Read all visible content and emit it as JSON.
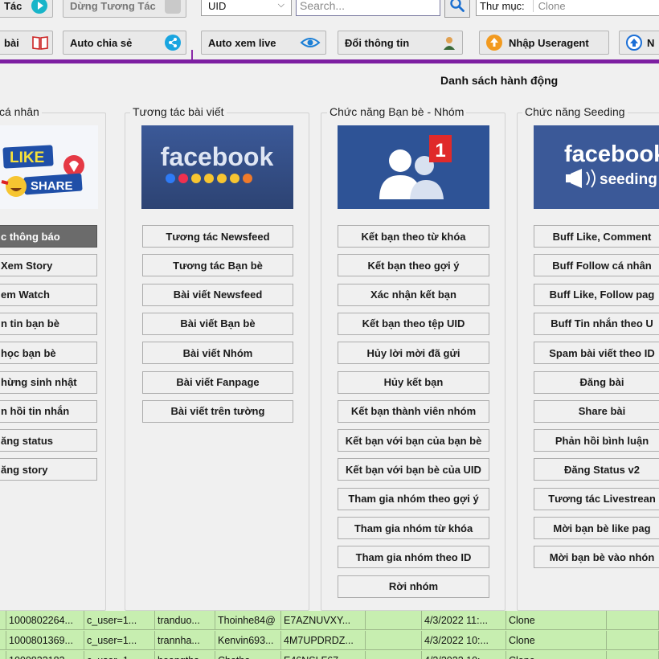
{
  "toolbar": {
    "row1": {
      "start_interact_label": "Tác",
      "stop_interact_label": "Dừng Tương Tác",
      "filter_select_value": "UID",
      "search_placeholder": "Search...",
      "folder_label": "Thư mục:",
      "folder_value": "Clone"
    },
    "row2": {
      "post_label": "bài",
      "auto_share_label": "Auto chia sẻ",
      "auto_live_label": "Auto xem live",
      "change_info_label": "Đổi thông tin",
      "import_useragent_label": "Nhập Useragent",
      "next_label": "N"
    }
  },
  "dialog": {
    "title": "Danh sách hành động",
    "groups": [
      {
        "title": "cá nhân",
        "banner_text": [
          "LIKE",
          "SHARE"
        ],
        "buttons": [
          "c thông báo",
          "Xem Story",
          "em Watch",
          "n tin bạn bè",
          "học bạn bè",
          "hừng sinh nhật",
          "n hồi tin nhắn",
          "ăng status",
          "ăng story"
        ]
      },
      {
        "title": "Tương tác bài viết",
        "banner_text": [
          "facebook"
        ],
        "buttons": [
          "Tương tác Newsfeed",
          "Tương tác Bạn bè",
          "Bài viết Newsfeed",
          "Bài viết Bạn bè",
          "Bài viết Nhóm",
          "Bài viết Fanpage",
          "Bài viết trên tường"
        ]
      },
      {
        "title": "Chức năng Bạn bè - Nhóm",
        "banner_text": [
          "1"
        ],
        "buttons": [
          "Kết bạn theo từ khóa",
          "Kết bạn theo gợi ý",
          "Xác nhận kết bạn",
          "Kết bạn theo tệp UID",
          "Hủy lời mời đã gửi",
          "Hủy kết bạn",
          "Kết bạn thành viên nhóm",
          "Kết bạn với bạn của bạn bè",
          "Kết bạn với bạn bè của UID",
          "Tham gia nhóm theo gợi ý",
          "Tham gia nhóm từ khóa",
          "Tham gia nhóm theo ID",
          "Rời nhóm"
        ]
      },
      {
        "title": "Chức năng Seeding",
        "banner_text": [
          "facebook",
          "seeding"
        ],
        "buttons": [
          "Buff Like, Comment",
          "Buff Follow cá nhân",
          "Buff Like, Follow pag",
          "Buff Tin nhắn theo U",
          "Spam bài viết theo ID",
          "Đăng bài",
          "Share bài",
          "Phản hồi bình luận",
          "Đăng Status v2",
          "Tương tác Livestrean",
          "Mời bạn bè like pag",
          "Mời bạn bè vào nhón"
        ]
      }
    ]
  },
  "grid": {
    "rows": [
      [
        "1000802264...",
        "c_user=1...",
        "tranduo...",
        "Thoinhe84@",
        "E7AZNUVXY...",
        "",
        "4/3/2022 11:...",
        "Clone"
      ],
      [
        "1000801369...",
        "c_user=1...",
        "trannha...",
        "Kenvin693...",
        "4M7UPDRDZ...",
        "",
        "4/3/2022 10:...",
        "Clone"
      ],
      [
        "1000833183...",
        "c_user=1...",
        "hoangtha...",
        "Chotha...",
        "E46NSLF67...",
        "",
        "4/3/2022 10:...",
        "Clone"
      ]
    ]
  },
  "colors": {
    "accent_purple": "#7d1fa2",
    "grid_green": "#c7eeb0",
    "facebook_blue": "#3b5998",
    "active_button": "#6b6b6b"
  }
}
